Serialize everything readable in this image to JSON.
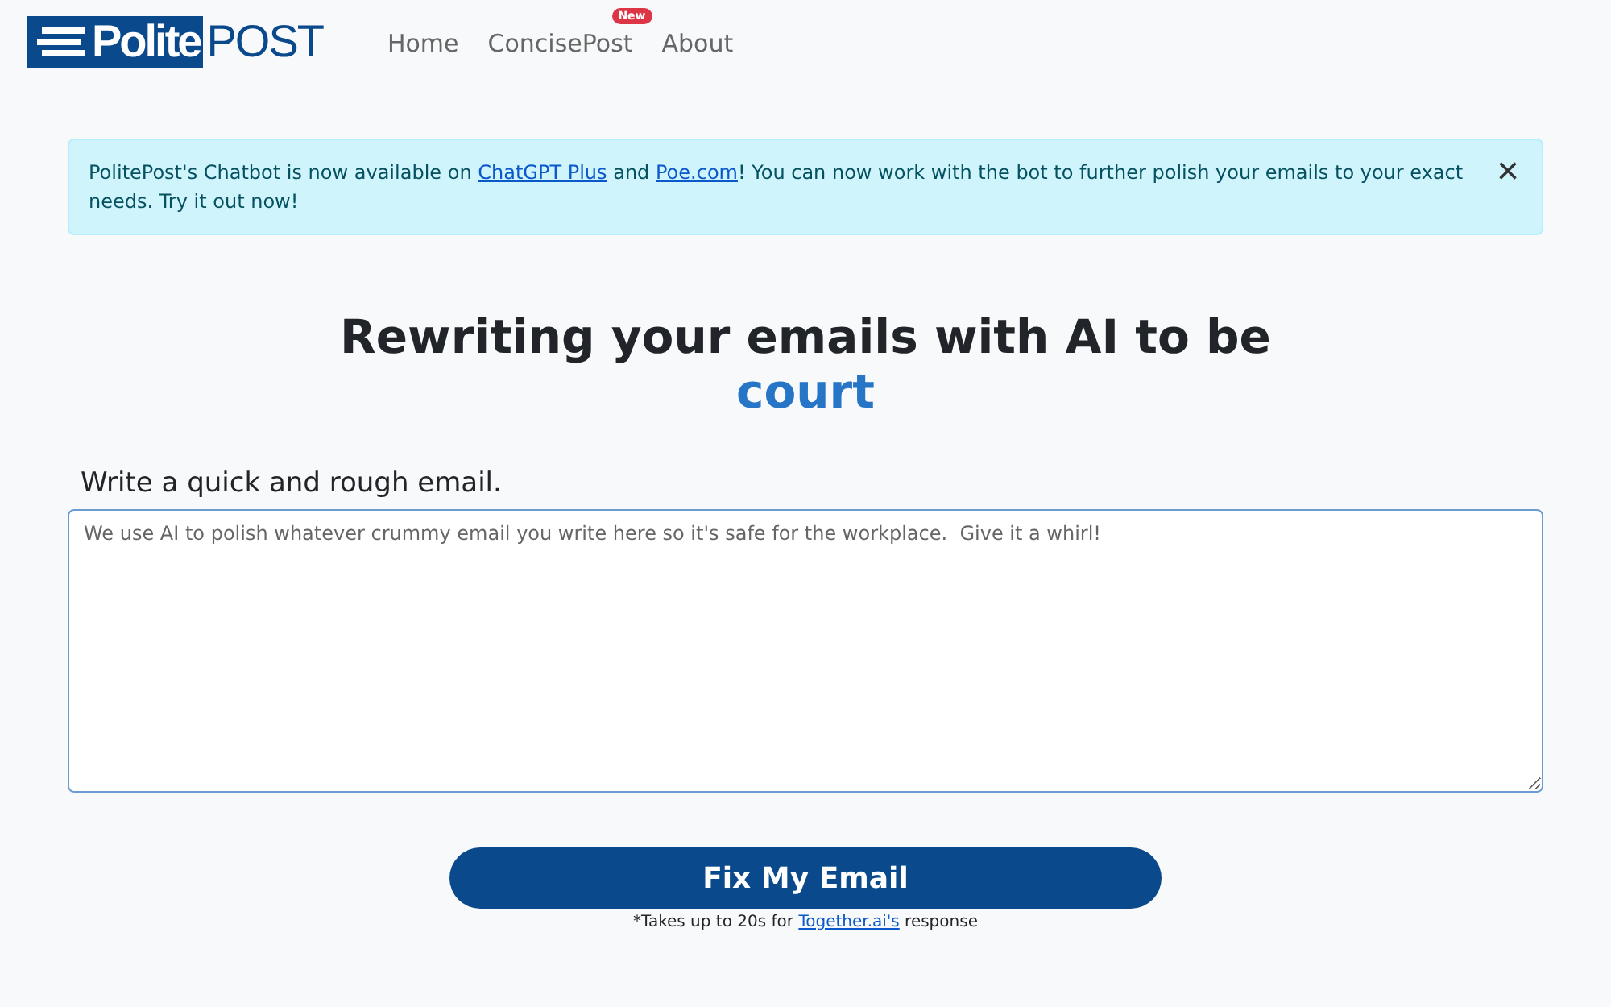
{
  "logo": {
    "text_boxed": "Polite",
    "text_plain": "POST"
  },
  "nav": [
    {
      "label": "Home"
    },
    {
      "label": "ConcisePost",
      "badge": "New"
    },
    {
      "label": "About"
    }
  ],
  "banner": {
    "segments": [
      {
        "kind": "text",
        "text": "PolitePost's Chatbot is now available on "
      },
      {
        "kind": "link",
        "text": "ChatGPT Plus"
      },
      {
        "kind": "text",
        "text": " and "
      },
      {
        "kind": "link",
        "text": "Poe.com"
      },
      {
        "kind": "text",
        "text": "! You can now work with the bot to further polish your emails to your exact needs. Try it out now!"
      }
    ],
    "close": "×"
  },
  "heading": {
    "line": "Rewriting your emails with AI to be",
    "word": "court"
  },
  "email": {
    "label": "Write a quick and rough email.",
    "placeholder": "We use AI to polish whatever crummy email you write here so it's safe for the workplace.  Give it a whirl!"
  },
  "submit": {
    "label": "Fix My Email"
  },
  "note": {
    "segments": [
      {
        "kind": "text",
        "text": "*Takes up to 20s for "
      },
      {
        "kind": "link",
        "text": "Together.ai's"
      },
      {
        "kind": "text",
        "text": " response"
      }
    ]
  }
}
